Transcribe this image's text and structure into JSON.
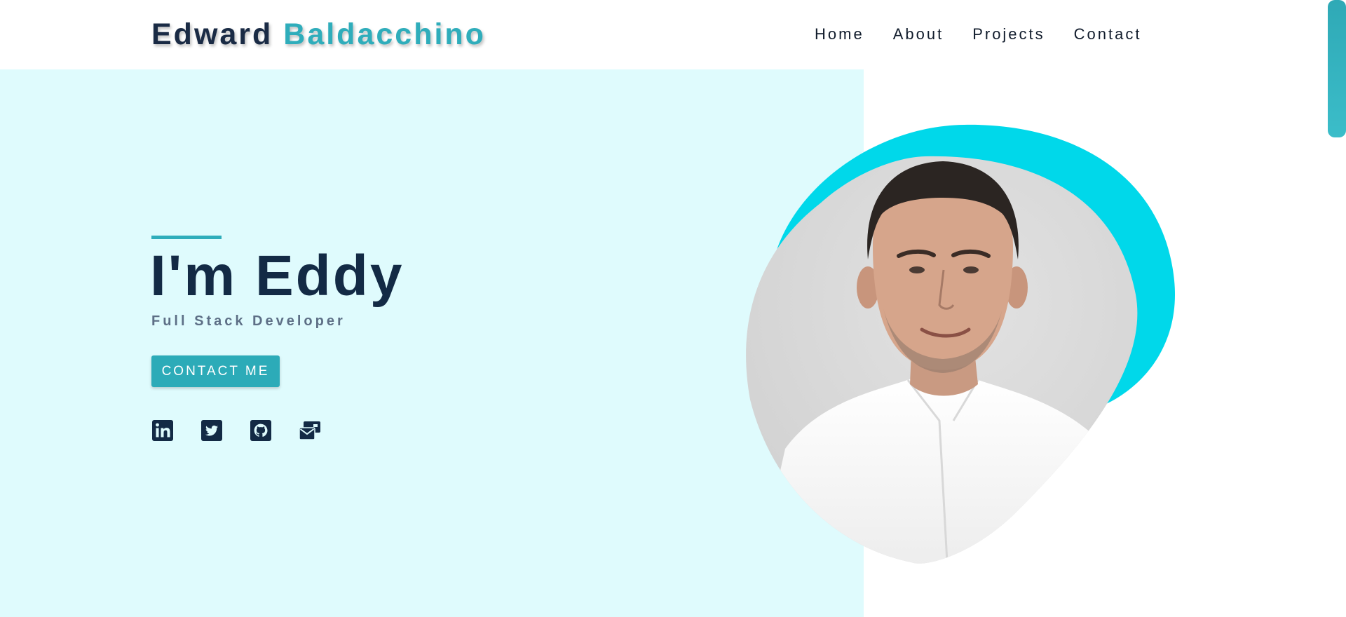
{
  "header": {
    "logo_first": "Edward",
    "logo_last": "Baldacchino",
    "nav": [
      {
        "label": "Home"
      },
      {
        "label": "About"
      },
      {
        "label": "Projects"
      },
      {
        "label": "Contact"
      }
    ]
  },
  "hero": {
    "title": "I'm Eddy",
    "subtitle": "Full Stack Developer",
    "cta_label": "CONTACT ME",
    "socials": [
      {
        "icon": "linkedin-icon"
      },
      {
        "icon": "twitter-icon"
      },
      {
        "icon": "github-icon"
      },
      {
        "icon": "mail-icon"
      }
    ],
    "portrait_icon": "profile-photo"
  },
  "colors": {
    "accent": "#2fadbb",
    "dark_navy": "#132a45",
    "panel_bg": "#dffbfd",
    "blob_cyan": "#00d8ea"
  }
}
